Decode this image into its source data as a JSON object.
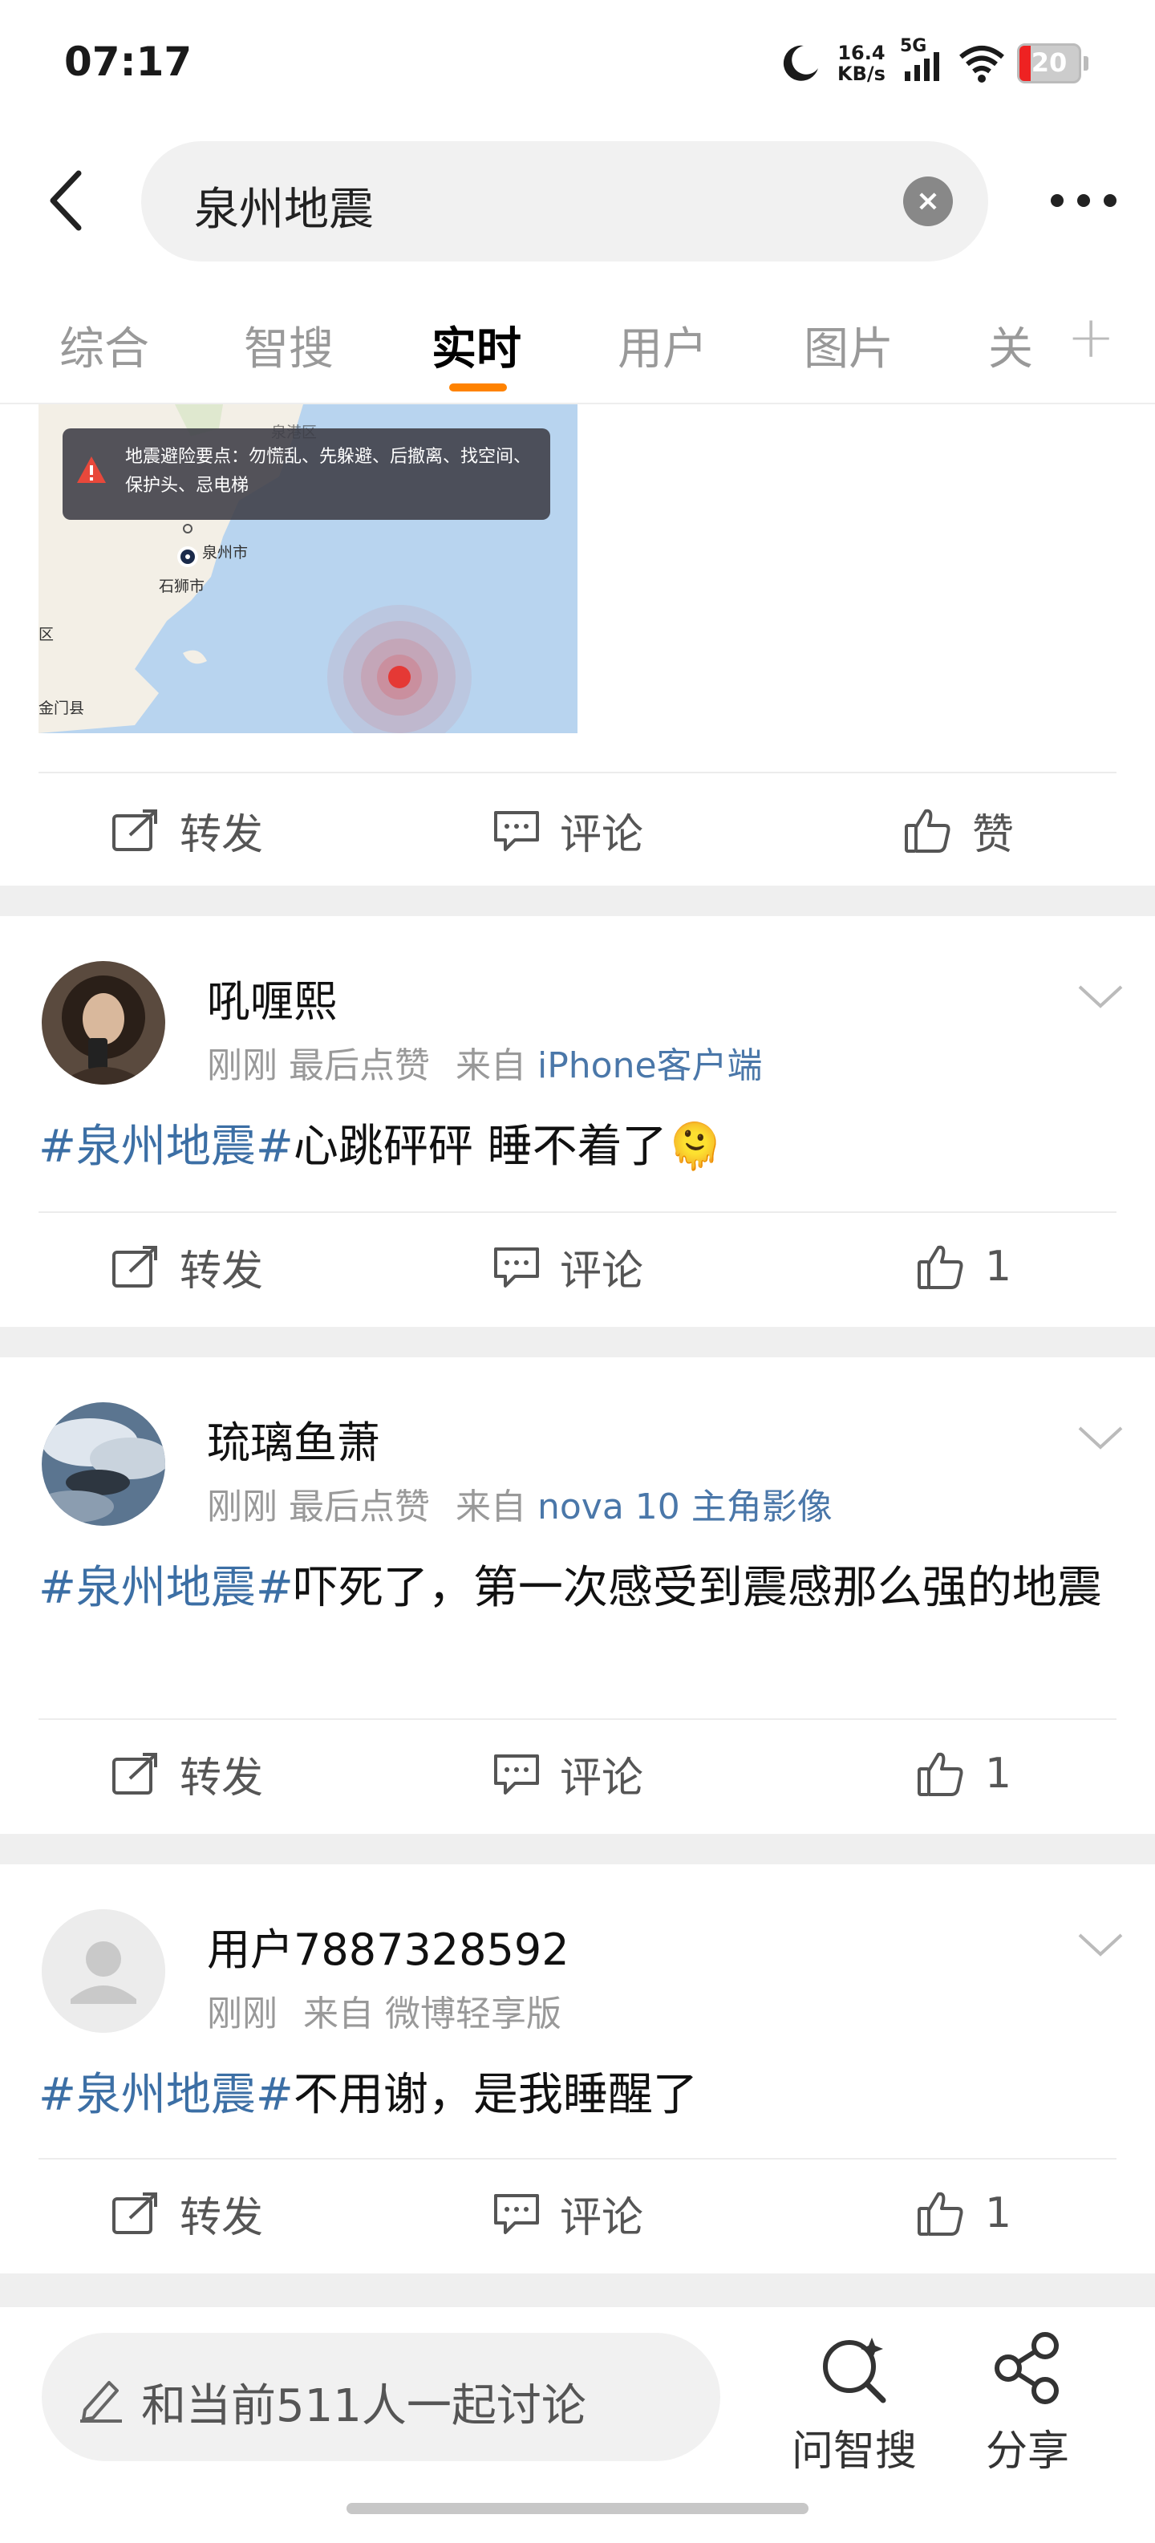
{
  "status_bar": {
    "time": "07:17",
    "speed_value": "16.4",
    "speed_unit": "KB/s",
    "network": "5G",
    "battery": "20"
  },
  "header": {
    "search_value": "泉州地震",
    "clear_icon": "clear-icon",
    "more_icon": "more-icon"
  },
  "tabs": [
    {
      "label": "综合",
      "active": false
    },
    {
      "label": "智搜",
      "active": false
    },
    {
      "label": "实时",
      "active": true
    },
    {
      "label": "用户",
      "active": false
    },
    {
      "label": "图片",
      "active": false
    },
    {
      "label": "关",
      "active": false
    }
  ],
  "map_card": {
    "alert_text": "地震避险要点：勿慌乱、先躲避、后撤离、找空间、保护头、忌电梯",
    "labels": [
      "泉州市",
      "石狮市",
      "金门县",
      "区",
      "泉港区"
    ]
  },
  "actions": {
    "repost": "转发",
    "comment": "评论",
    "like": "赞"
  },
  "posts": [
    {
      "username": "吼喱熙",
      "time": "刚刚",
      "liked_note": "最后点赞",
      "from_label": "来自",
      "source": "iPhone客户端",
      "hashtag": "#泉州地震#",
      "text": "心跳砰砰 睡不着了",
      "emoji": "🫠",
      "likes": "1"
    },
    {
      "username": "琉璃鱼萧",
      "time": "刚刚",
      "liked_note": "最后点赞",
      "from_label": "来自",
      "source": "nova 10 主角影像",
      "hashtag": "#泉州地震#",
      "text": "吓死了，第一次感受到震感那么强的地震",
      "likes": "1"
    },
    {
      "username": "用户7887328592",
      "time": "刚刚",
      "from_label": "来自",
      "source": "微博轻享版",
      "hashtag": "#泉州地震#",
      "text": "不用谢，是我睡醒了",
      "likes": "1"
    }
  ],
  "bottom_bar": {
    "discuss_placeholder": "和当前511人一起讨论",
    "ask_label": "问智搜",
    "share_label": "分享"
  },
  "colors": {
    "accent": "#ff8200",
    "link": "#3c6fa5",
    "meta": "#999999",
    "epicenter": "#e53935"
  }
}
